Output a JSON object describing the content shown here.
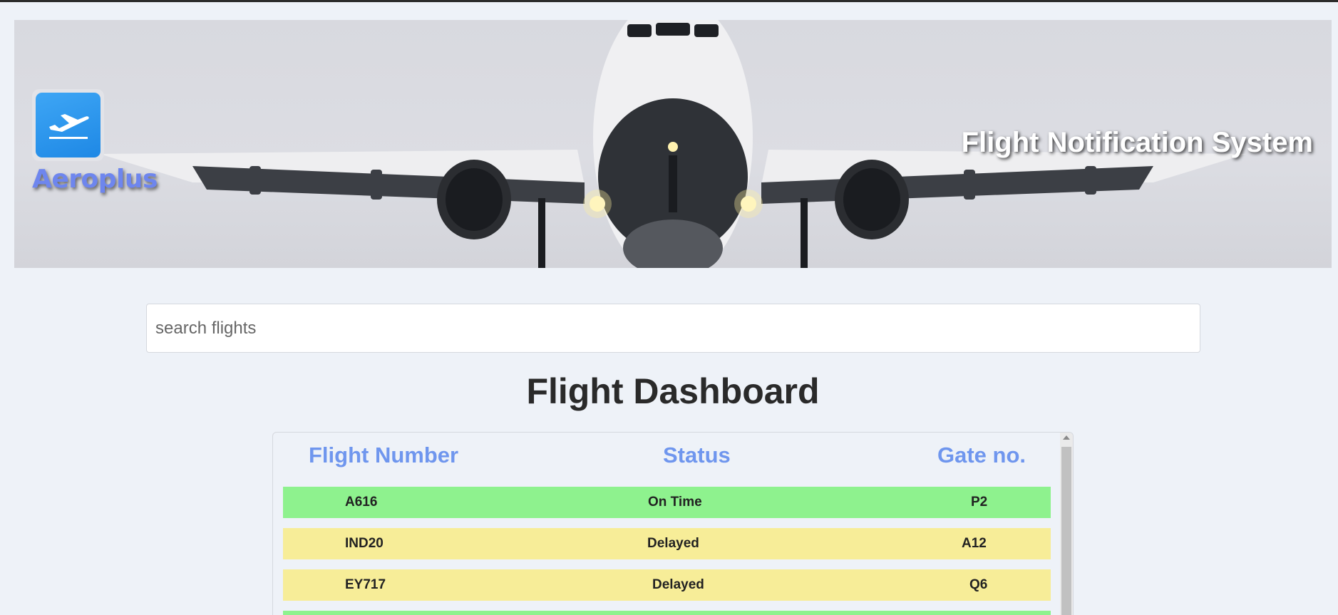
{
  "app": {
    "brand_name": "Aeroplus",
    "system_title": "Flight Notification System"
  },
  "icons": {
    "logo": "airplane-takeoff-icon",
    "scroll_up": "scroll-up-arrow-icon"
  },
  "search": {
    "placeholder": "search flights",
    "value": ""
  },
  "dashboard": {
    "title": "Flight Dashboard",
    "columns": [
      "Flight Number",
      "Status",
      "Gate no."
    ],
    "rows": [
      {
        "flight": "A616",
        "status": "On Time",
        "gate": "P2",
        "color": "#8ef28e"
      },
      {
        "flight": "IND20",
        "status": "Delayed",
        "gate": "A12",
        "color": "#f7ed98"
      },
      {
        "flight": "EY717",
        "status": "Delayed",
        "gate": "Q6",
        "color": "#f7ed98"
      },
      {
        "flight": "",
        "status": "",
        "gate": "",
        "color": "#8ef28e"
      }
    ]
  },
  "colors": {
    "page_bg": "#eef2f8",
    "on_time": "#8ef28e",
    "delayed": "#f7ed98",
    "header_text": "#6f96ee",
    "brand_text": "#6e86ee",
    "logo_bg": "#2196f3"
  }
}
